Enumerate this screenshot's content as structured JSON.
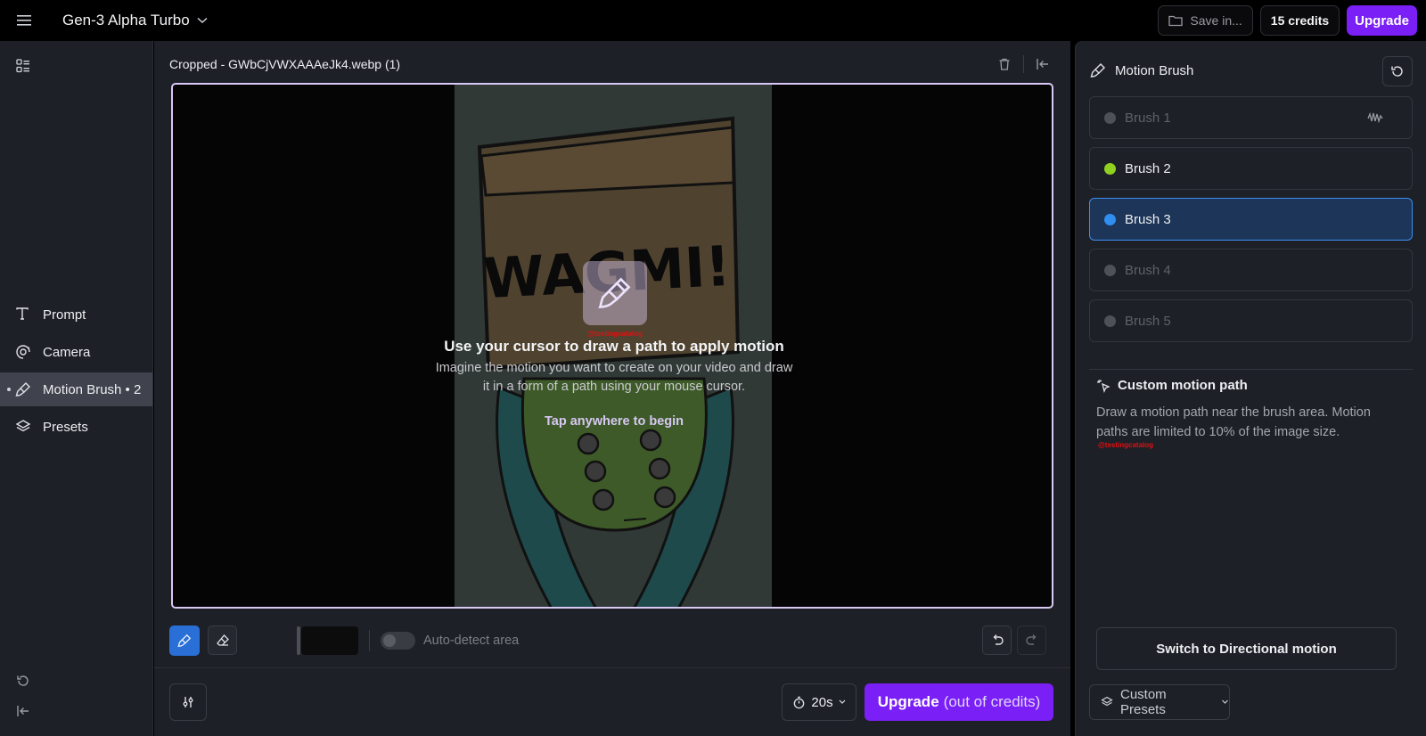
{
  "topbar": {
    "model": "Gen-3 Alpha Turbo",
    "save_label": "Save in...",
    "credits_label": "15 credits",
    "upgrade_label": "Upgrade"
  },
  "sidebar": {
    "items": [
      {
        "label": "Prompt",
        "icon": "text-icon"
      },
      {
        "label": "Camera",
        "icon": "camera-icon"
      },
      {
        "label": "Motion Brush • 2",
        "icon": "brush-icon",
        "active": true
      },
      {
        "label": "Presets",
        "icon": "layers-icon"
      }
    ]
  },
  "editor": {
    "file_title": "Cropped - GWbCjVWXAAAeJk4.webp (1)",
    "image_text": "WAGMI!",
    "watermark": "@testingcatalog",
    "overlay_title": "Use your cursor to draw a path to apply motion",
    "overlay_desc": "Imagine the motion you want to create on your video and draw it in a form of a path using your mouse cursor.",
    "overlay_begin": "Tap anywhere to begin",
    "auto_detect_label": "Auto-detect area",
    "auto_detect_on": false,
    "duration_label": "20s",
    "generate_label": "Upgrade",
    "generate_sub": "(out of credits)"
  },
  "right_panel": {
    "title": "Motion Brush",
    "brushes": [
      {
        "label": "Brush 1",
        "color": "#4f5159",
        "state": "disabled"
      },
      {
        "label": "Brush 2",
        "color": "#8fd11e",
        "state": "enabled"
      },
      {
        "label": "Brush 3",
        "color": "#2f8ef0",
        "state": "selected"
      },
      {
        "label": "Brush 4",
        "color": "#4f5159",
        "state": "disabled"
      },
      {
        "label": "Brush 5",
        "color": "#4f5159",
        "state": "disabled"
      }
    ],
    "custom_title": "Custom motion path",
    "custom_desc": "Draw a motion path near the brush area. Motion paths are limited to 10% of the image size.",
    "watermark": "@testingcatalog",
    "switch_label": "Switch to Directional motion",
    "presets_label": "Custom Presets"
  },
  "colors": {
    "accent": "#7a1ff5",
    "selected_brush_bg": "#1d3558",
    "selected_brush_border": "#3b8ff0",
    "brush_tool_active": "#2a6fd6"
  }
}
